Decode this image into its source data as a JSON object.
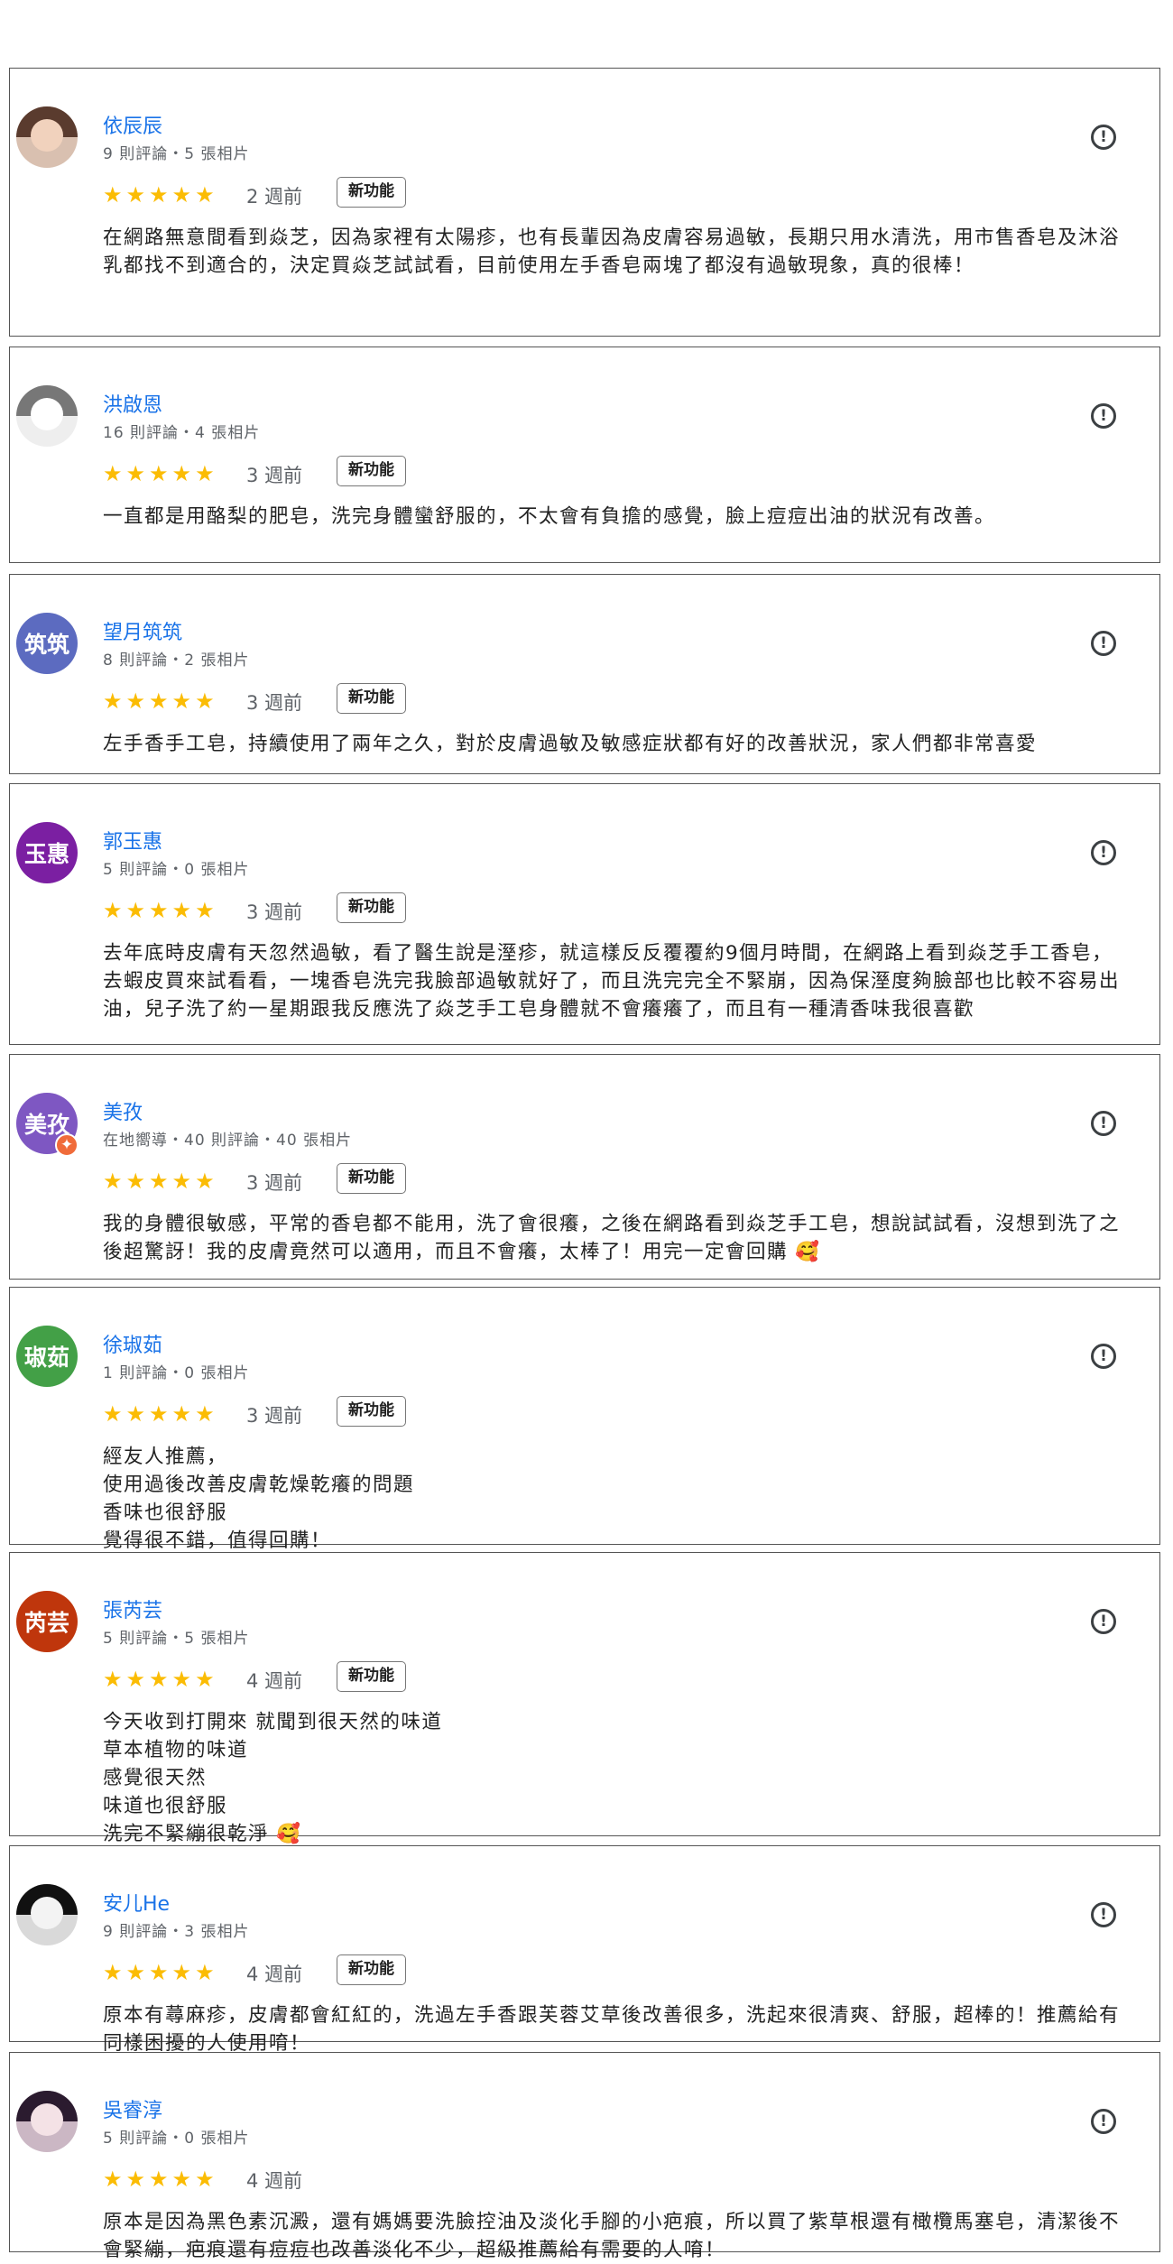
{
  "report_icon_glyph": "!",
  "new_feature_label": "新功能",
  "star_glyphs": "★★★★★",
  "rating": 5,
  "reviews": [
    {
      "name": "依辰辰",
      "meta": "9 則評論・5 張相片",
      "time": "2 週前",
      "text": "在網路無意間看到焱芝，因為家裡有太陽疹，也有長輩因為皮膚容易過敏，長期只用水清洗，用市售香皂及沐浴乳都找不到適合的，決定買焱芝試試看，目前使用左手香皂兩塊了都沒有過敏現象，真的很棒！"
    },
    {
      "name": "洪啟恩",
      "meta": "16 則評論・4 張相片",
      "time": "3 週前",
      "text": "一直都是用酪梨的肥皂，洗完身體蠻舒服的，不太會有負擔的感覺，臉上痘痘出油的狀況有改善。"
    },
    {
      "name": "望月筑筑",
      "avatar_text": "筑筑",
      "avatar_color": "#5c6bc0",
      "meta": "8 則評論・2 張相片",
      "time": "3 週前",
      "text": "左手香手工皂，持續使用了兩年之久，對於皮膚過敏及敏感症狀都有好的改善狀況，家人們都非常喜愛"
    },
    {
      "name": "郭玉惠",
      "avatar_text": "玉惠",
      "avatar_color": "#7b1fa2",
      "meta": "5 則評論・0 張相片",
      "time": "3 週前",
      "text": "去年底時皮膚有天忽然過敏，看了醫生說是溼疹，就這樣反反覆覆約9個月時間，在網路上看到焱芝手工香皂，去蝦皮買來試看看，一塊香皂洗完我臉部過敏就好了，而且洗完完全不緊崩，因為保溼度夠臉部也比較不容易出油，兒子洗了約一星期跟我反應洗了焱芝手工皂身體就不會癢癢了，而且有一種清香味我很喜歡"
    },
    {
      "name": "美孜",
      "avatar_text": "美孜",
      "avatar_color": "#7e57c2",
      "meta": "在地嚮導・40 則評論・40 張相片",
      "time": "3 週前",
      "text": "我的身體很敏感，平常的香皂都不能用，洗了會很癢，之後在網路看到焱芝手工皂，想說試試看，沒想到洗了之後超驚訝！我的皮膚竟然可以適用，而且不會癢，太棒了！用完一定會回購 🥰"
    },
    {
      "name": "徐琡茹",
      "avatar_text": "琡茹",
      "avatar_color": "#43a047",
      "meta": "1 則評論・0 張相片",
      "time": "3 週前",
      "lines": [
        "經友人推薦，",
        "使用過後改善皮膚乾燥乾癢的問題",
        "香味也很舒服",
        "覺得很不錯，值得回購！"
      ]
    },
    {
      "name": "張芮芸",
      "avatar_text": "芮芸",
      "avatar_color": "#bf360c",
      "meta": "5 則評論・5 張相片",
      "time": "4 週前",
      "lines": [
        "今天收到打開來 就聞到很天然的味道",
        "草本植物的味道",
        "感覺很天然",
        "味道也很舒服",
        "洗完不緊繃很乾淨 🥰"
      ]
    },
    {
      "name": "安儿He",
      "meta": "9 則評論・3 張相片",
      "time": "4 週前",
      "text": "原本有蕁麻疹，皮膚都會紅紅的，洗過左手香跟芙蓉艾草後改善很多，洗起來很清爽、舒服，超棒的！推薦給有同樣困擾的人使用唷！"
    },
    {
      "name": "吳睿淳",
      "meta": "5 則評論・0 張相片",
      "time": "4 週前",
      "text": "原本是因為黑色素沉澱，還有媽媽要洗臉控油及淡化手腳的小疤痕，所以買了紫草根還有橄欖馬塞皂，清潔後不會緊繃，疤痕還有痘痘也改善淡化不少，超級推薦給有需要的人唷！"
    }
  ]
}
